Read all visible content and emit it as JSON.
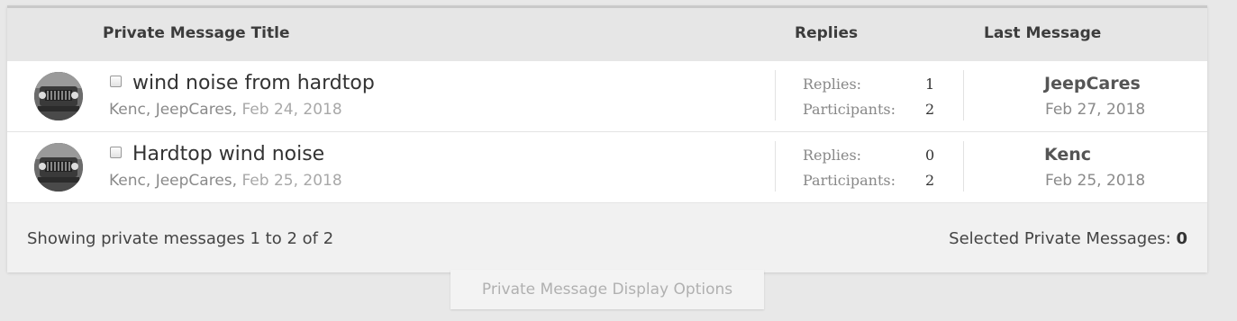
{
  "table": {
    "header": {
      "title_col": "Private Message Title",
      "replies_col": "Replies",
      "last_col": "Last Message"
    },
    "rows": [
      {
        "title": "wind noise from hardtop",
        "participants_text": "Kenc, JeepCares,",
        "date": "Feb 24, 2018",
        "replies_label": "Replies:",
        "replies": "1",
        "participants_label": "Participants:",
        "participants": "2",
        "last_user": "JeepCares",
        "last_date": "Feb 27, 2018"
      },
      {
        "title": "Hardtop wind noise",
        "participants_text": "Kenc, JeepCares,",
        "date": "Feb 25, 2018",
        "replies_label": "Replies:",
        "replies": "0",
        "participants_label": "Participants:",
        "participants": "2",
        "last_user": "Kenc",
        "last_date": "Feb 25, 2018"
      }
    ]
  },
  "footer": {
    "showing": "Showing private messages 1 to 2 of 2",
    "selected_label": "Selected Private Messages:",
    "selected_count": "0"
  },
  "options_tab": "Private Message Display Options",
  "icons": {
    "avatar": "jeep-avatar-icon",
    "checkbox": "checkbox-icon"
  }
}
